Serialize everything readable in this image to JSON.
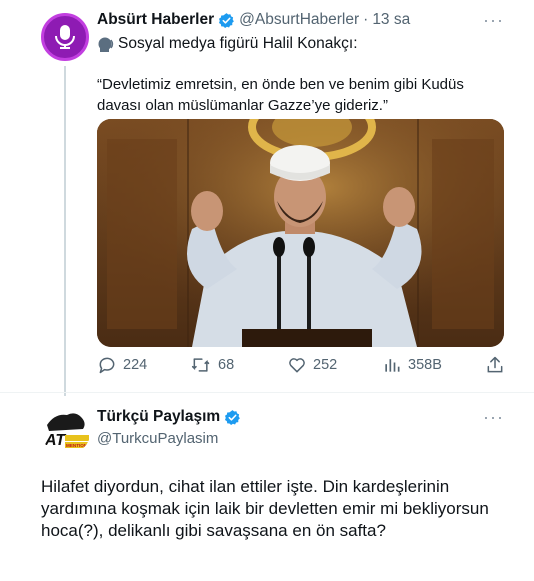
{
  "tweet1": {
    "author_name": "Absürt Haberler",
    "handle": "@AbsurtHaberler",
    "separator": "·",
    "time": "13 sa",
    "more_label": "···",
    "subline": "Sosyal medya figürü Halil Konakçı:",
    "quote": "“Devletimiz emretsin, en önde ben ve benim gibi Kudüs davası olan müslümanlar Gazze’ye gideriz.”",
    "actions": {
      "replies": "224",
      "retweets": "68",
      "likes": "252",
      "views": "358B"
    },
    "avatar_color": "#8e1bb3"
  },
  "tweet2": {
    "author_name": "Türkçü Paylaşım",
    "handle": "@TurkcuPaylasim",
    "more_label": "···",
    "body": "Hilafet diyordun, cihat ilan ettiler işte. Din kardeşlerinin yardımına koşmak için laik bir devletten emir mi bekliyorsun hoca(?), delikanlı gibi savaşsana en ön safta?",
    "avatar_text": "AT",
    "avatar_subtext": "MENTION"
  },
  "colors": {
    "verified": "#1d9bf0",
    "muted": "#536471",
    "text": "#0f1419"
  }
}
